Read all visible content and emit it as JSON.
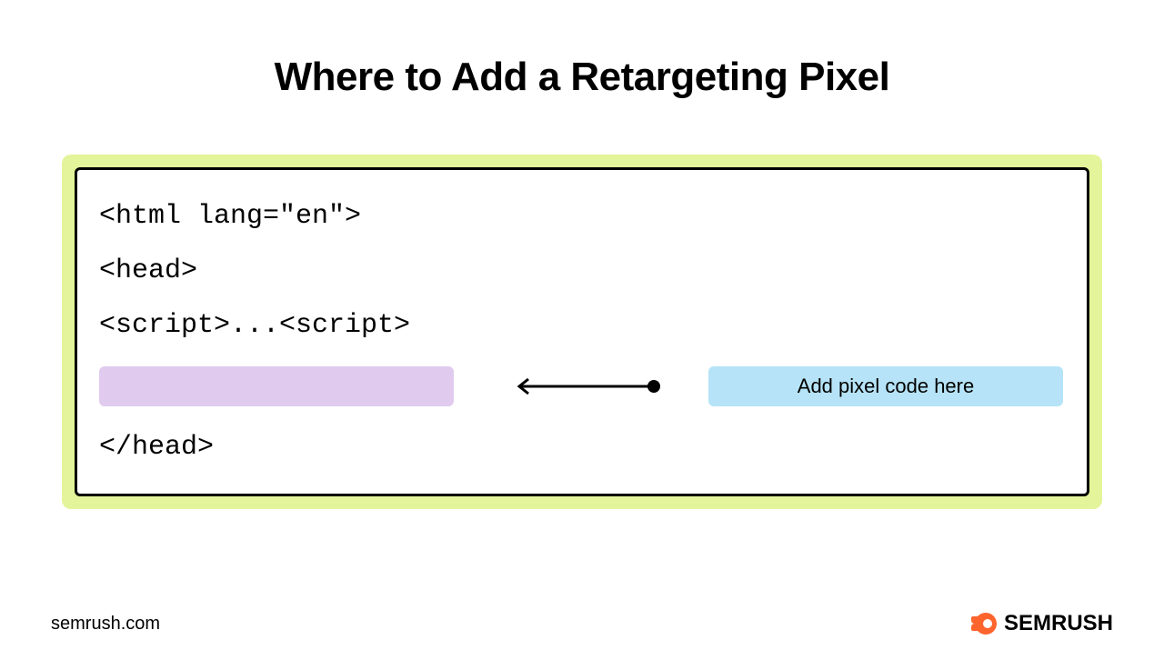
{
  "title": "Where to Add a Retargeting Pixel",
  "code": {
    "line1": "<html lang=\"en\">",
    "line2": "<head>",
    "line3": "<script>...<script>",
    "line4": "</head>"
  },
  "annotation": {
    "label": "Add pixel code here"
  },
  "footer": {
    "url": "semrush.com",
    "brand": "SEMRUSH"
  },
  "colors": {
    "highlight_bg": "#e4f49a",
    "purple_box": "#e0cbef",
    "blue_label": "#b6e3f7",
    "brand_orange": "#ff642d"
  }
}
